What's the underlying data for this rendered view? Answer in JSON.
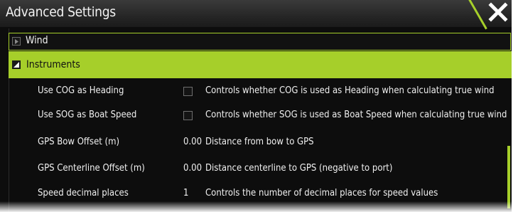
{
  "window": {
    "title": "Advanced Settings",
    "close_icon": "close-icon",
    "accent_color": "#a6cf2a"
  },
  "groups": [
    {
      "label": "Wind",
      "expanded": false,
      "icon": "expand-arrow-icon"
    },
    {
      "label": "Instruments",
      "expanded": true,
      "icon": "collapse-arrow-icon"
    }
  ],
  "settings": [
    {
      "name": "Use COG as Heading",
      "control": "checkbox",
      "checked": false,
      "value": "",
      "description": "Controls whether COG is used as Heading when calculating true wind"
    },
    {
      "name": "Use SOG as Boat Speed",
      "control": "checkbox",
      "checked": false,
      "value": "",
      "description": "Controls whether SOG is used as Boat Speed when calculating true wind"
    },
    {
      "name": "GPS Bow Offset (m)",
      "control": "value",
      "value": "0.00",
      "description": "Distance from bow to GPS"
    },
    {
      "name": "GPS Centerline Offset (m)",
      "control": "value",
      "value": "0.00",
      "description": "Distance centerline to GPS (negative to port)"
    },
    {
      "name": "Speed decimal places",
      "control": "value",
      "value": "1",
      "description": "Controls the number of decimal places for speed values"
    }
  ]
}
